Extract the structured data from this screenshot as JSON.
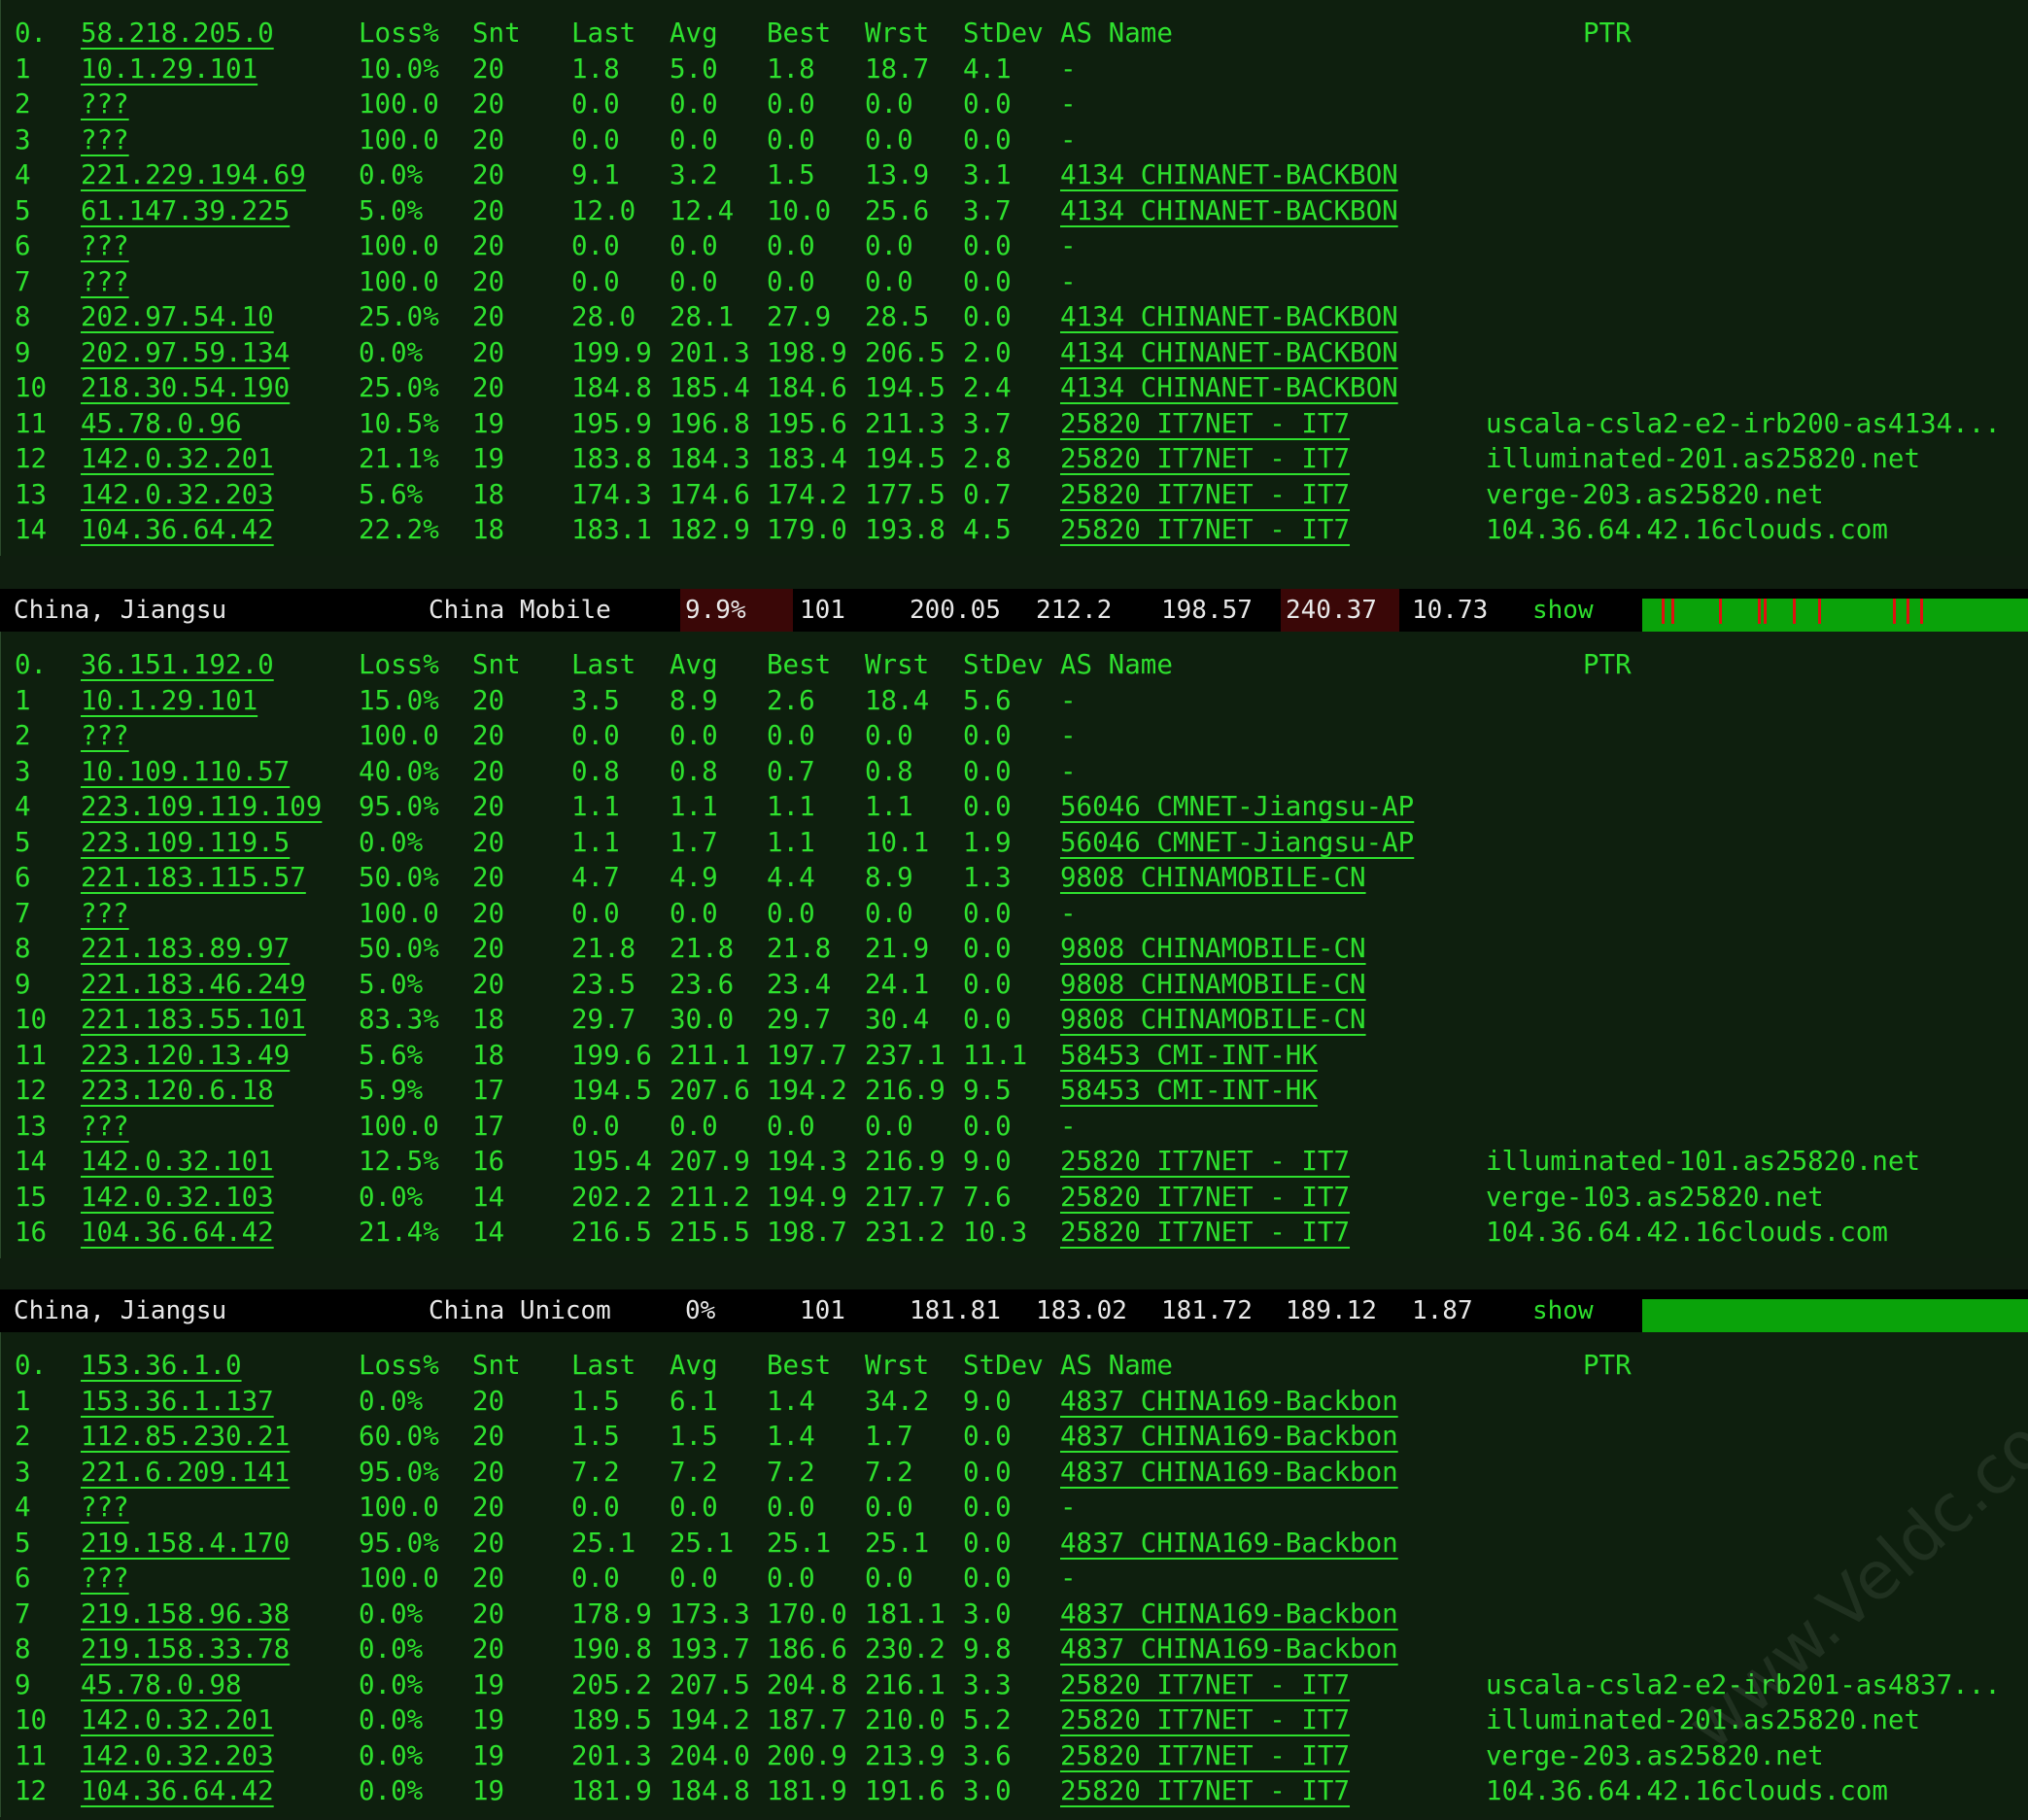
{
  "header": {
    "loss": "Loss%",
    "snt": "Snt",
    "last": "Last",
    "avg": "Avg",
    "best": "Best",
    "wrst": "Wrst",
    "stdev": "StDev",
    "as_name": "AS Name",
    "ptr": "PTR"
  },
  "traces": [
    {
      "hops": [
        {
          "idx": "0.",
          "ip": "58.218.205.0",
          "header": true
        },
        {
          "idx": "1",
          "ip": "10.1.29.101",
          "loss": "10.0%",
          "snt": "20",
          "last": "1.8",
          "avg": "5.0",
          "best": "1.8",
          "wrst": "18.7",
          "stdev": "4.1",
          "as": "-",
          "ptr": ""
        },
        {
          "idx": "2",
          "ip": "???",
          "loss": "100.0",
          "snt": "20",
          "last": "0.0",
          "avg": "0.0",
          "best": "0.0",
          "wrst": "0.0",
          "stdev": "0.0",
          "as": "-",
          "ptr": ""
        },
        {
          "idx": "3",
          "ip": "???",
          "loss": "100.0",
          "snt": "20",
          "last": "0.0",
          "avg": "0.0",
          "best": "0.0",
          "wrst": "0.0",
          "stdev": "0.0",
          "as": "-",
          "ptr": ""
        },
        {
          "idx": "4",
          "ip": "221.229.194.69",
          "loss": "0.0%",
          "snt": "20",
          "last": "9.1",
          "avg": "3.2",
          "best": "1.5",
          "wrst": "13.9",
          "stdev": "3.1",
          "as": "4134  CHINANET-BACKBON",
          "ptr": ""
        },
        {
          "idx": "5",
          "ip": "61.147.39.225",
          "loss": "5.0%",
          "snt": "20",
          "last": "12.0",
          "avg": "12.4",
          "best": "10.0",
          "wrst": "25.6",
          "stdev": "3.7",
          "as": "4134  CHINANET-BACKBON",
          "ptr": ""
        },
        {
          "idx": "6",
          "ip": "???",
          "loss": "100.0",
          "snt": "20",
          "last": "0.0",
          "avg": "0.0",
          "best": "0.0",
          "wrst": "0.0",
          "stdev": "0.0",
          "as": "-",
          "ptr": ""
        },
        {
          "idx": "7",
          "ip": "???",
          "loss": "100.0",
          "snt": "20",
          "last": "0.0",
          "avg": "0.0",
          "best": "0.0",
          "wrst": "0.0",
          "stdev": "0.0",
          "as": "-",
          "ptr": ""
        },
        {
          "idx": "8",
          "ip": "202.97.54.10",
          "loss": "25.0%",
          "snt": "20",
          "last": "28.0",
          "avg": "28.1",
          "best": "27.9",
          "wrst": "28.5",
          "stdev": "0.0",
          "as": "4134  CHINANET-BACKBON",
          "ptr": ""
        },
        {
          "idx": "9",
          "ip": "202.97.59.134",
          "loss": "0.0%",
          "snt": "20",
          "last": "199.9",
          "avg": "201.3",
          "best": "198.9",
          "wrst": "206.5",
          "stdev": "2.0",
          "as": "4134  CHINANET-BACKBON",
          "ptr": ""
        },
        {
          "idx": "10",
          "ip": "218.30.54.190",
          "loss": "25.0%",
          "snt": "20",
          "last": "184.8",
          "avg": "185.4",
          "best": "184.6",
          "wrst": "194.5",
          "stdev": "2.4",
          "as": "4134  CHINANET-BACKBON",
          "ptr": ""
        },
        {
          "idx": "11",
          "ip": "45.78.0.96",
          "loss": "10.5%",
          "snt": "19",
          "last": "195.9",
          "avg": "196.8",
          "best": "195.6",
          "wrst": "211.3",
          "stdev": "3.7",
          "as": "25820 IT7NET - IT7",
          "ptr": "uscala-csla2-e2-irb200-as4134..."
        },
        {
          "idx": "12",
          "ip": "142.0.32.201",
          "loss": "21.1%",
          "snt": "19",
          "last": "183.8",
          "avg": "184.3",
          "best": "183.4",
          "wrst": "194.5",
          "stdev": "2.8",
          "as": "25820 IT7NET - IT7",
          "ptr": "illuminated-201.as25820.net"
        },
        {
          "idx": "13",
          "ip": "142.0.32.203",
          "loss": "5.6%",
          "snt": "18",
          "last": "174.3",
          "avg": "174.6",
          "best": "174.2",
          "wrst": "177.5",
          "stdev": "0.7",
          "as": "25820 IT7NET - IT7",
          "ptr": "verge-203.as25820.net"
        },
        {
          "idx": "14",
          "ip": "104.36.64.42",
          "loss": "22.2%",
          "snt": "18",
          "last": "183.1",
          "avg": "182.9",
          "best": "179.0",
          "wrst": "193.8",
          "stdev": "4.5",
          "as": "25820 IT7NET - IT7",
          "ptr": "104.36.64.42.16clouds.com"
        }
      ],
      "summary": {
        "location": "China, Jiangsu",
        "isp": "China Mobile",
        "loss": "9.9%",
        "snt": "101",
        "last": "200.05",
        "avg": "212.2",
        "best": "198.57",
        "wrst": "240.37",
        "stdev": "10.73",
        "show": "show",
        "loss_highlight": true,
        "wrst_highlight": true,
        "spark_red": [
          0.05,
          0.075,
          0.2,
          0.3,
          0.315,
          0.39,
          0.455,
          0.65,
          0.685,
          0.72
        ]
      }
    },
    {
      "hops": [
        {
          "idx": "0.",
          "ip": "36.151.192.0",
          "header": true
        },
        {
          "idx": "1",
          "ip": "10.1.29.101",
          "loss": "15.0%",
          "snt": "20",
          "last": "3.5",
          "avg": "8.9",
          "best": "2.6",
          "wrst": "18.4",
          "stdev": "5.6",
          "as": "-",
          "ptr": ""
        },
        {
          "idx": "2",
          "ip": "???",
          "loss": "100.0",
          "snt": "20",
          "last": "0.0",
          "avg": "0.0",
          "best": "0.0",
          "wrst": "0.0",
          "stdev": "0.0",
          "as": "-",
          "ptr": ""
        },
        {
          "idx": "3",
          "ip": "10.109.110.57",
          "loss": "40.0%",
          "snt": "20",
          "last": "0.8",
          "avg": "0.8",
          "best": "0.7",
          "wrst": "0.8",
          "stdev": "0.0",
          "as": "-",
          "ptr": ""
        },
        {
          "idx": "4",
          "ip": "223.109.119.109",
          "loss": "95.0%",
          "snt": "20",
          "last": "1.1",
          "avg": "1.1",
          "best": "1.1",
          "wrst": "1.1",
          "stdev": "0.0",
          "as": "56046 CMNET-Jiangsu-AP",
          "ptr": ""
        },
        {
          "idx": "5",
          "ip": "223.109.119.5",
          "loss": "0.0%",
          "snt": "20",
          "last": "1.1",
          "avg": "1.7",
          "best": "1.1",
          "wrst": "10.1",
          "stdev": "1.9",
          "as": "56046 CMNET-Jiangsu-AP",
          "ptr": ""
        },
        {
          "idx": "6",
          "ip": "221.183.115.57",
          "loss": "50.0%",
          "snt": "20",
          "last": "4.7",
          "avg": "4.9",
          "best": "4.4",
          "wrst": "8.9",
          "stdev": "1.3",
          "as": "9808  CHINAMOBILE-CN",
          "ptr": ""
        },
        {
          "idx": "7",
          "ip": "???",
          "loss": "100.0",
          "snt": "20",
          "last": "0.0",
          "avg": "0.0",
          "best": "0.0",
          "wrst": "0.0",
          "stdev": "0.0",
          "as": "-",
          "ptr": ""
        },
        {
          "idx": "8",
          "ip": "221.183.89.97",
          "loss": "50.0%",
          "snt": "20",
          "last": "21.8",
          "avg": "21.8",
          "best": "21.8",
          "wrst": "21.9",
          "stdev": "0.0",
          "as": "9808  CHINAMOBILE-CN",
          "ptr": ""
        },
        {
          "idx": "9",
          "ip": "221.183.46.249",
          "loss": "5.0%",
          "snt": "20",
          "last": "23.5",
          "avg": "23.6",
          "best": "23.4",
          "wrst": "24.1",
          "stdev": "0.0",
          "as": "9808  CHINAMOBILE-CN",
          "ptr": ""
        },
        {
          "idx": "10",
          "ip": "221.183.55.101",
          "loss": "83.3%",
          "snt": "18",
          "last": "29.7",
          "avg": "30.0",
          "best": "29.7",
          "wrst": "30.4",
          "stdev": "0.0",
          "as": "9808  CHINAMOBILE-CN",
          "ptr": ""
        },
        {
          "idx": "11",
          "ip": "223.120.13.49",
          "loss": "5.6%",
          "snt": "18",
          "last": "199.6",
          "avg": "211.1",
          "best": "197.7",
          "wrst": "237.1",
          "stdev": "11.1",
          "as": "58453 CMI-INT-HK",
          "ptr": ""
        },
        {
          "idx": "12",
          "ip": "223.120.6.18",
          "loss": "5.9%",
          "snt": "17",
          "last": "194.5",
          "avg": "207.6",
          "best": "194.2",
          "wrst": "216.9",
          "stdev": "9.5",
          "as": "58453 CMI-INT-HK",
          "ptr": ""
        },
        {
          "idx": "13",
          "ip": "???",
          "loss": "100.0",
          "snt": "17",
          "last": "0.0",
          "avg": "0.0",
          "best": "0.0",
          "wrst": "0.0",
          "stdev": "0.0",
          "as": "-",
          "ptr": ""
        },
        {
          "idx": "14",
          "ip": "142.0.32.101",
          "loss": "12.5%",
          "snt": "16",
          "last": "195.4",
          "avg": "207.9",
          "best": "194.3",
          "wrst": "216.9",
          "stdev": "9.0",
          "as": "25820 IT7NET - IT7",
          "ptr": "illuminated-101.as25820.net"
        },
        {
          "idx": "15",
          "ip": "142.0.32.103",
          "loss": "0.0%",
          "snt": "14",
          "last": "202.2",
          "avg": "211.2",
          "best": "194.9",
          "wrst": "217.7",
          "stdev": "7.6",
          "as": "25820 IT7NET - IT7",
          "ptr": "verge-103.as25820.net"
        },
        {
          "idx": "16",
          "ip": "104.36.64.42",
          "loss": "21.4%",
          "snt": "14",
          "last": "216.5",
          "avg": "215.5",
          "best": "198.7",
          "wrst": "231.2",
          "stdev": "10.3",
          "as": "25820 IT7NET - IT7",
          "ptr": "104.36.64.42.16clouds.com"
        }
      ],
      "summary": {
        "location": "China, Jiangsu",
        "isp": "China Unicom",
        "loss": "0%",
        "snt": "101",
        "last": "181.81",
        "avg": "183.02",
        "best": "181.72",
        "wrst": "189.12",
        "stdev": "1.87",
        "show": "show",
        "loss_highlight": false,
        "wrst_highlight": false,
        "spark_red": []
      }
    },
    {
      "hops": [
        {
          "idx": "0.",
          "ip": "153.36.1.0",
          "header": true
        },
        {
          "idx": "1",
          "ip": "153.36.1.137",
          "loss": "0.0%",
          "snt": "20",
          "last": "1.5",
          "avg": "6.1",
          "best": "1.4",
          "wrst": "34.2",
          "stdev": "9.0",
          "as": "4837  CHINA169-Backbon",
          "ptr": ""
        },
        {
          "idx": "2",
          "ip": "112.85.230.21",
          "loss": "60.0%",
          "snt": "20",
          "last": "1.5",
          "avg": "1.5",
          "best": "1.4",
          "wrst": "1.7",
          "stdev": "0.0",
          "as": "4837  CHINA169-Backbon",
          "ptr": ""
        },
        {
          "idx": "3",
          "ip": "221.6.209.141",
          "loss": "95.0%",
          "snt": "20",
          "last": "7.2",
          "avg": "7.2",
          "best": "7.2",
          "wrst": "7.2",
          "stdev": "0.0",
          "as": "4837  CHINA169-Backbon",
          "ptr": ""
        },
        {
          "idx": "4",
          "ip": "???",
          "loss": "100.0",
          "snt": "20",
          "last": "0.0",
          "avg": "0.0",
          "best": "0.0",
          "wrst": "0.0",
          "stdev": "0.0",
          "as": "-",
          "ptr": ""
        },
        {
          "idx": "5",
          "ip": "219.158.4.170",
          "loss": "95.0%",
          "snt": "20",
          "last": "25.1",
          "avg": "25.1",
          "best": "25.1",
          "wrst": "25.1",
          "stdev": "0.0",
          "as": "4837  CHINA169-Backbon",
          "ptr": ""
        },
        {
          "idx": "6",
          "ip": "???",
          "loss": "100.0",
          "snt": "20",
          "last": "0.0",
          "avg": "0.0",
          "best": "0.0",
          "wrst": "0.0",
          "stdev": "0.0",
          "as": "-",
          "ptr": ""
        },
        {
          "idx": "7",
          "ip": "219.158.96.38",
          "loss": "0.0%",
          "snt": "20",
          "last": "178.9",
          "avg": "173.3",
          "best": "170.0",
          "wrst": "181.1",
          "stdev": "3.0",
          "as": "4837  CHINA169-Backbon",
          "ptr": ""
        },
        {
          "idx": "8",
          "ip": "219.158.33.78",
          "loss": "0.0%",
          "snt": "20",
          "last": "190.8",
          "avg": "193.7",
          "best": "186.6",
          "wrst": "230.2",
          "stdev": "9.8",
          "as": "4837  CHINA169-Backbon",
          "ptr": ""
        },
        {
          "idx": "9",
          "ip": "45.78.0.98",
          "loss": "0.0%",
          "snt": "19",
          "last": "205.2",
          "avg": "207.5",
          "best": "204.8",
          "wrst": "216.1",
          "stdev": "3.3",
          "as": "25820 IT7NET - IT7",
          "ptr": "uscala-csla2-e2-irb201-as4837..."
        },
        {
          "idx": "10",
          "ip": "142.0.32.201",
          "loss": "0.0%",
          "snt": "19",
          "last": "189.5",
          "avg": "194.2",
          "best": "187.7",
          "wrst": "210.0",
          "stdev": "5.2",
          "as": "25820 IT7NET - IT7",
          "ptr": "illuminated-201.as25820.net"
        },
        {
          "idx": "11",
          "ip": "142.0.32.203",
          "loss": "0.0%",
          "snt": "19",
          "last": "201.3",
          "avg": "204.0",
          "best": "200.9",
          "wrst": "213.9",
          "stdev": "3.6",
          "as": "25820 IT7NET - IT7",
          "ptr": "verge-203.as25820.net"
        },
        {
          "idx": "12",
          "ip": "104.36.64.42",
          "loss": "0.0%",
          "snt": "19",
          "last": "181.9",
          "avg": "184.8",
          "best": "181.9",
          "wrst": "191.6",
          "stdev": "3.0",
          "as": "25820 IT7NET - IT7",
          "ptr": "104.36.64.42.16clouds.com"
        }
      ]
    }
  ],
  "watermark": "www.Veldc.com",
  "colors": {
    "text": "#2ee02e",
    "bg": "#0e1f0e",
    "summary_bg": "#000000",
    "highlight": "#3a0707",
    "spark": "#0aa30a",
    "spark_loss": "#e01010"
  }
}
